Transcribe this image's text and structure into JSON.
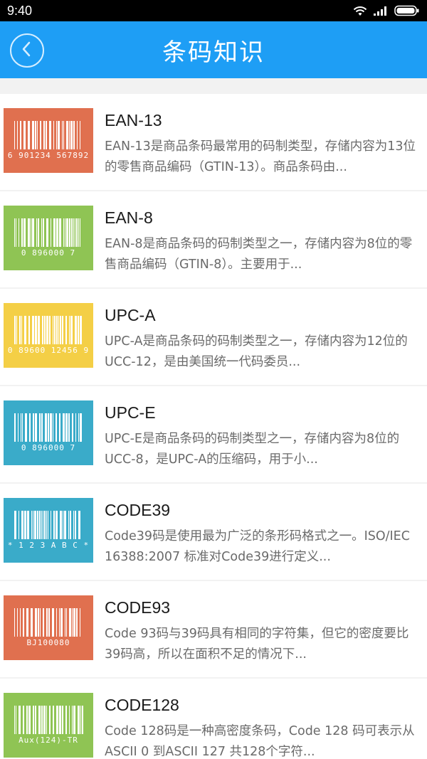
{
  "status_bar": {
    "time": "9:40",
    "icons": [
      "wifi-icon",
      "signal-icon",
      "battery-icon"
    ]
  },
  "header": {
    "title": "条码知识",
    "back_icon": "chevron-left-icon",
    "color": "#1e9ef5"
  },
  "items": [
    {
      "name": "EAN-13",
      "description": "EAN-13是商品条码最常用的码制类型，存储内容为13位的零售商品编码（GTIN-13）。商品条码由...",
      "thumb_color": "#e0704f",
      "thumb_caption": "6 901234 567892"
    },
    {
      "name": "EAN-8",
      "description": "EAN-8是商品条码的码制类型之一，存储内容为8位的零售商品编码（GTIN-8）。主要用于...",
      "thumb_color": "#8fc454",
      "thumb_caption": "0 896000 7"
    },
    {
      "name": "UPC-A",
      "description": "UPC-A是商品条码的码制类型之一，存储内容为12位的UCC-12，是由美国统一代码委员...",
      "thumb_color": "#f4cf46",
      "thumb_caption": "0 89600 12456 9"
    },
    {
      "name": "UPC-E",
      "description": "UPC-E是商品条码的码制类型之一，存储内容为8位的UCC-8，是UPC-A的压缩码，用于小...",
      "thumb_color": "#3aabc9",
      "thumb_caption": "0 896000 7"
    },
    {
      "name": "CODE39",
      "description": "Code39码是使用最为广泛的条形码格式之一。ISO/IEC 16388:2007 标准对Code39进行定义...",
      "thumb_color": "#3aabc9",
      "thumb_caption": "* 1 2 3 A B C *"
    },
    {
      "name": "CODE93",
      "description": "Code 93码与39码具有相同的字符集，但它的密度要比39码高，所以在面积不足的情况下...",
      "thumb_color": "#e0704f",
      "thumb_caption": "BJ100080"
    },
    {
      "name": "CODE128",
      "description": "Code 128码是一种高密度条码，Code 128 码可表示从 ASCII 0 到ASCII 127 共128个字符...",
      "thumb_color": "#8fc454",
      "thumb_caption": "Aux(124)-TR"
    }
  ]
}
